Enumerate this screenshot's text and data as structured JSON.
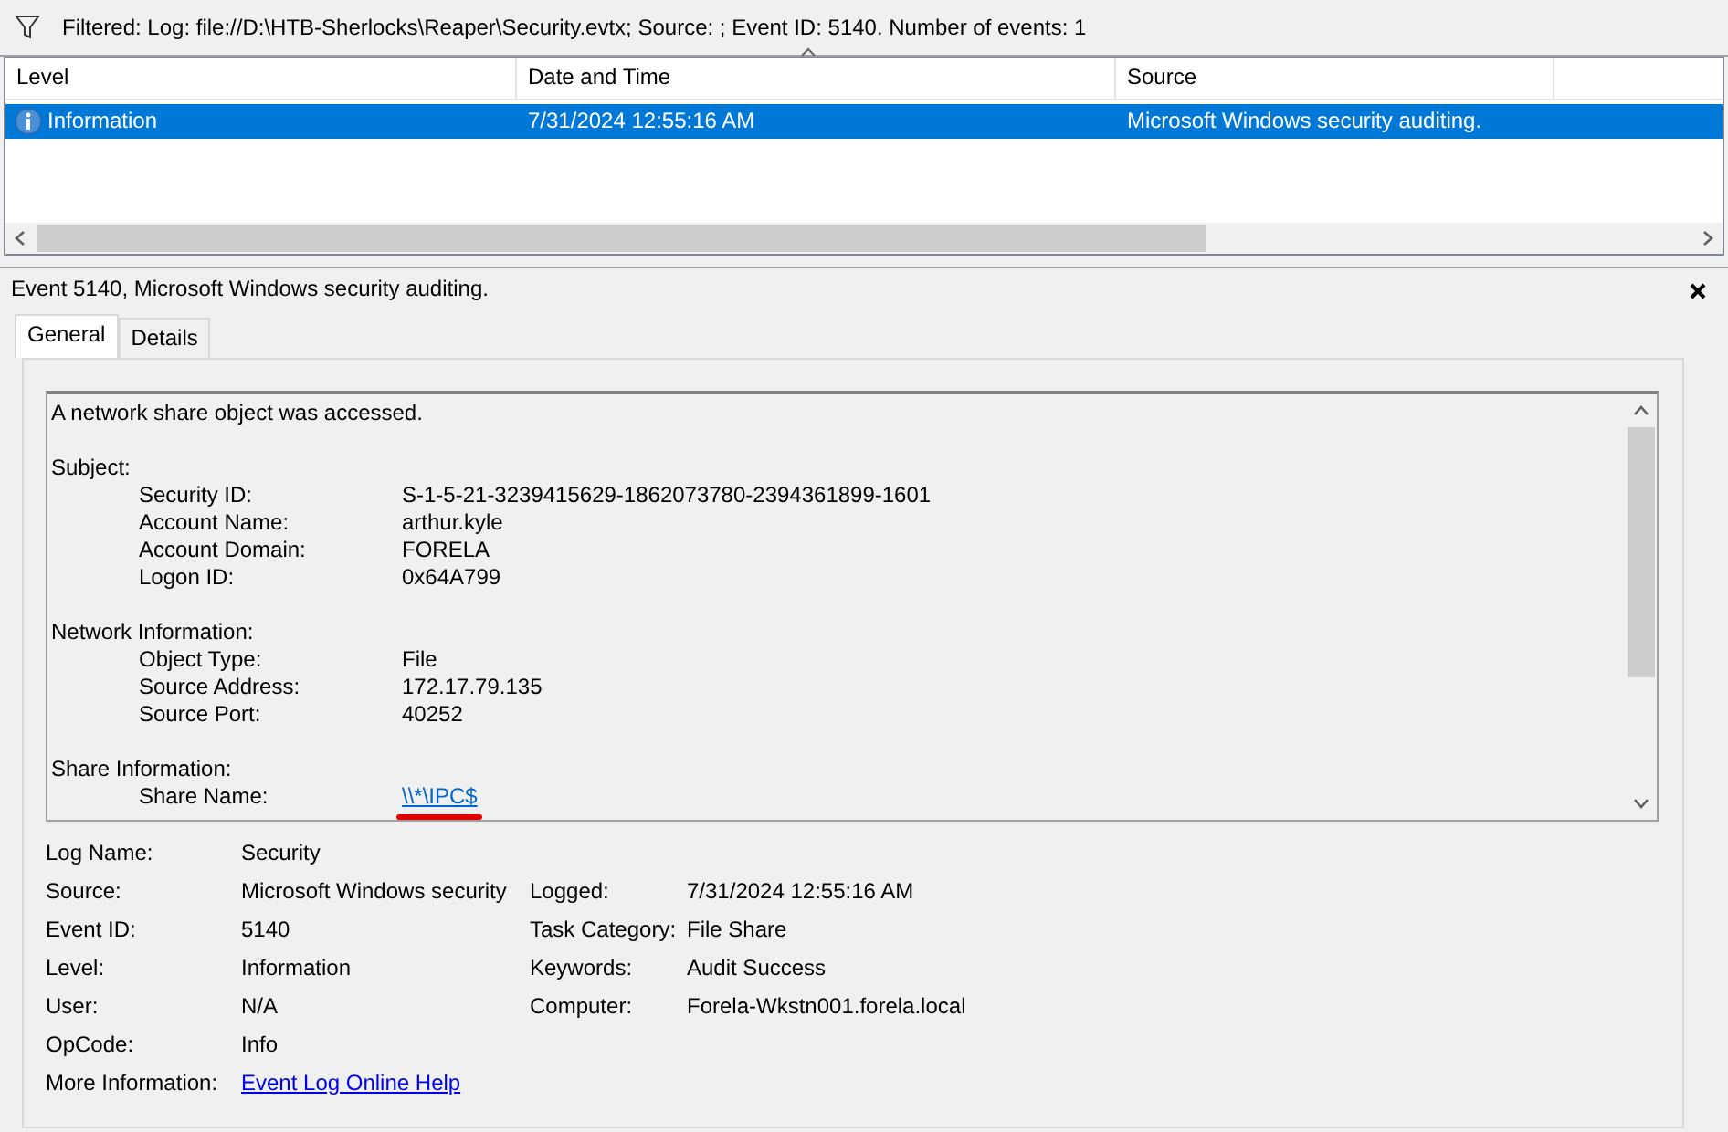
{
  "filter_bar": {
    "text": "Filtered: Log: file://D:\\HTB-Sherlocks\\Reaper\\Security.evtx; Source: ; Event ID: 5140. Number of events: 1"
  },
  "event_list": {
    "columns": [
      {
        "label": "Level"
      },
      {
        "label": "Date and Time",
        "sorted": true
      },
      {
        "label": "Source"
      }
    ],
    "rows": [
      {
        "level": "Information",
        "date_time": "7/31/2024 12:55:16 AM",
        "source": "Microsoft Windows security auditing.",
        "selected": true
      }
    ]
  },
  "detail": {
    "title": "Event 5140, Microsoft Windows security auditing.",
    "tabs": [
      {
        "label": "General",
        "selected": true
      },
      {
        "label": "Details",
        "selected": false
      }
    ],
    "description": {
      "intro": "A network share object was accessed.",
      "sections": [
        {
          "heading": "Subject:",
          "fields": [
            {
              "label": "Security ID:",
              "value": "S-1-5-21-3239415629-1862073780-2394361899-1601",
              "kind": "text"
            },
            {
              "label": "Account Name:",
              "value": "arthur.kyle",
              "kind": "text"
            },
            {
              "label": "Account Domain:",
              "value": "FORELA",
              "kind": "text"
            },
            {
              "label": "Logon ID:",
              "value": "0x64A799",
              "kind": "text"
            }
          ]
        },
        {
          "heading": "Network Information:",
          "fields": [
            {
              "label": "Object Type:",
              "value": "File",
              "kind": "text"
            },
            {
              "label": "Source Address:",
              "value": "172.17.79.135",
              "kind": "text"
            },
            {
              "label": "Source Port:",
              "value": "40252",
              "kind": "text"
            }
          ]
        },
        {
          "heading": "Share Information:",
          "fields": [
            {
              "label": "Share Name:",
              "value": "\\\\*\\IPC$",
              "kind": "link",
              "annotated": true
            }
          ]
        }
      ]
    },
    "property_rows": [
      [
        {
          "label": "Log Name:",
          "value": "Security",
          "kind": "text"
        }
      ],
      [
        {
          "label": "Source:",
          "value": "Microsoft Windows security",
          "kind": "text"
        },
        {
          "label": "Logged:",
          "value": "7/31/2024 12:55:16 AM",
          "kind": "text"
        }
      ],
      [
        {
          "label": "Event ID:",
          "value": "5140",
          "kind": "text"
        },
        {
          "label": "Task Category:",
          "value": "File Share",
          "kind": "text"
        }
      ],
      [
        {
          "label": "Level:",
          "value": "Information",
          "kind": "text"
        },
        {
          "label": "Keywords:",
          "value": "Audit Success",
          "kind": "text"
        }
      ],
      [
        {
          "label": "User:",
          "value": "N/A",
          "kind": "text"
        },
        {
          "label": "Computer:",
          "value": "Forela-Wkstn001.forela.local",
          "kind": "text"
        }
      ],
      [
        {
          "label": "OpCode:",
          "value": "Info",
          "kind": "text"
        }
      ],
      [
        {
          "label": "More Information:",
          "value": "Event Log Online Help",
          "kind": "link"
        }
      ]
    ]
  }
}
